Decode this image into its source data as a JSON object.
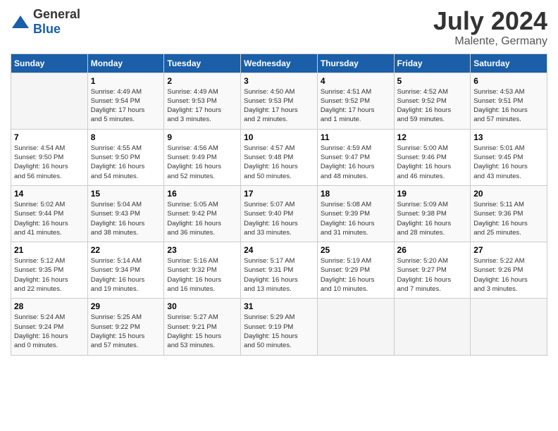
{
  "logo": {
    "general": "General",
    "blue": "Blue"
  },
  "title": "July 2024",
  "location": "Malente, Germany",
  "days_of_week": [
    "Sunday",
    "Monday",
    "Tuesday",
    "Wednesday",
    "Thursday",
    "Friday",
    "Saturday"
  ],
  "weeks": [
    [
      {
        "num": "",
        "info": ""
      },
      {
        "num": "1",
        "info": "Sunrise: 4:49 AM\nSunset: 9:54 PM\nDaylight: 17 hours\nand 5 minutes."
      },
      {
        "num": "2",
        "info": "Sunrise: 4:49 AM\nSunset: 9:53 PM\nDaylight: 17 hours\nand 3 minutes."
      },
      {
        "num": "3",
        "info": "Sunrise: 4:50 AM\nSunset: 9:53 PM\nDaylight: 17 hours\nand 2 minutes."
      },
      {
        "num": "4",
        "info": "Sunrise: 4:51 AM\nSunset: 9:52 PM\nDaylight: 17 hours\nand 1 minute."
      },
      {
        "num": "5",
        "info": "Sunrise: 4:52 AM\nSunset: 9:52 PM\nDaylight: 16 hours\nand 59 minutes."
      },
      {
        "num": "6",
        "info": "Sunrise: 4:53 AM\nSunset: 9:51 PM\nDaylight: 16 hours\nand 57 minutes."
      }
    ],
    [
      {
        "num": "7",
        "info": "Sunrise: 4:54 AM\nSunset: 9:50 PM\nDaylight: 16 hours\nand 56 minutes."
      },
      {
        "num": "8",
        "info": "Sunrise: 4:55 AM\nSunset: 9:50 PM\nDaylight: 16 hours\nand 54 minutes."
      },
      {
        "num": "9",
        "info": "Sunrise: 4:56 AM\nSunset: 9:49 PM\nDaylight: 16 hours\nand 52 minutes."
      },
      {
        "num": "10",
        "info": "Sunrise: 4:57 AM\nSunset: 9:48 PM\nDaylight: 16 hours\nand 50 minutes."
      },
      {
        "num": "11",
        "info": "Sunrise: 4:59 AM\nSunset: 9:47 PM\nDaylight: 16 hours\nand 48 minutes."
      },
      {
        "num": "12",
        "info": "Sunrise: 5:00 AM\nSunset: 9:46 PM\nDaylight: 16 hours\nand 46 minutes."
      },
      {
        "num": "13",
        "info": "Sunrise: 5:01 AM\nSunset: 9:45 PM\nDaylight: 16 hours\nand 43 minutes."
      }
    ],
    [
      {
        "num": "14",
        "info": "Sunrise: 5:02 AM\nSunset: 9:44 PM\nDaylight: 16 hours\nand 41 minutes."
      },
      {
        "num": "15",
        "info": "Sunrise: 5:04 AM\nSunset: 9:43 PM\nDaylight: 16 hours\nand 38 minutes."
      },
      {
        "num": "16",
        "info": "Sunrise: 5:05 AM\nSunset: 9:42 PM\nDaylight: 16 hours\nand 36 minutes."
      },
      {
        "num": "17",
        "info": "Sunrise: 5:07 AM\nSunset: 9:40 PM\nDaylight: 16 hours\nand 33 minutes."
      },
      {
        "num": "18",
        "info": "Sunrise: 5:08 AM\nSunset: 9:39 PM\nDaylight: 16 hours\nand 31 minutes."
      },
      {
        "num": "19",
        "info": "Sunrise: 5:09 AM\nSunset: 9:38 PM\nDaylight: 16 hours\nand 28 minutes."
      },
      {
        "num": "20",
        "info": "Sunrise: 5:11 AM\nSunset: 9:36 PM\nDaylight: 16 hours\nand 25 minutes."
      }
    ],
    [
      {
        "num": "21",
        "info": "Sunrise: 5:12 AM\nSunset: 9:35 PM\nDaylight: 16 hours\nand 22 minutes."
      },
      {
        "num": "22",
        "info": "Sunrise: 5:14 AM\nSunset: 9:34 PM\nDaylight: 16 hours\nand 19 minutes."
      },
      {
        "num": "23",
        "info": "Sunrise: 5:16 AM\nSunset: 9:32 PM\nDaylight: 16 hours\nand 16 minutes."
      },
      {
        "num": "24",
        "info": "Sunrise: 5:17 AM\nSunset: 9:31 PM\nDaylight: 16 hours\nand 13 minutes."
      },
      {
        "num": "25",
        "info": "Sunrise: 5:19 AM\nSunset: 9:29 PM\nDaylight: 16 hours\nand 10 minutes."
      },
      {
        "num": "26",
        "info": "Sunrise: 5:20 AM\nSunset: 9:27 PM\nDaylight: 16 hours\nand 7 minutes."
      },
      {
        "num": "27",
        "info": "Sunrise: 5:22 AM\nSunset: 9:26 PM\nDaylight: 16 hours\nand 3 minutes."
      }
    ],
    [
      {
        "num": "28",
        "info": "Sunrise: 5:24 AM\nSunset: 9:24 PM\nDaylight: 16 hours\nand 0 minutes."
      },
      {
        "num": "29",
        "info": "Sunrise: 5:25 AM\nSunset: 9:22 PM\nDaylight: 15 hours\nand 57 minutes."
      },
      {
        "num": "30",
        "info": "Sunrise: 5:27 AM\nSunset: 9:21 PM\nDaylight: 15 hours\nand 53 minutes."
      },
      {
        "num": "31",
        "info": "Sunrise: 5:29 AM\nSunset: 9:19 PM\nDaylight: 15 hours\nand 50 minutes."
      },
      {
        "num": "",
        "info": ""
      },
      {
        "num": "",
        "info": ""
      },
      {
        "num": "",
        "info": ""
      }
    ]
  ]
}
